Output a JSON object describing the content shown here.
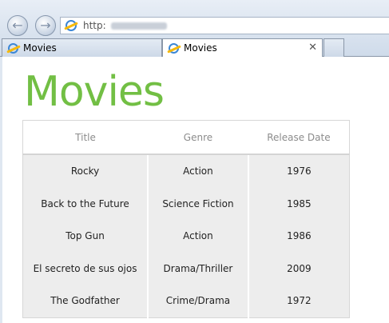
{
  "browser": {
    "address": {
      "url_prefix": "http:"
    },
    "tabs": [
      {
        "label": "Movies"
      },
      {
        "label": "Movies",
        "close": "✕"
      }
    ]
  },
  "page": {
    "title": "Movies",
    "table": {
      "headers": [
        "Title",
        "Genre",
        "Release Date"
      ],
      "rows": [
        [
          "Rocky",
          "Action",
          "1976"
        ],
        [
          "Back to the Future",
          "Science Fiction",
          "1985"
        ],
        [
          "Top Gun",
          "Action",
          "1986"
        ],
        [
          "El secreto de sus ojos",
          "Drama/Thriller",
          "2009"
        ],
        [
          "The Godfather",
          "Crime/Drama",
          "1972"
        ]
      ]
    }
  },
  "colors": {
    "title": "#72bf44",
    "row_bg": "#ededed",
    "header_text": "#8c8c8c"
  },
  "icons": {
    "back": "arrow-left-icon",
    "forward": "arrow-right-icon",
    "page": "ie-icon",
    "close": "close-icon"
  }
}
